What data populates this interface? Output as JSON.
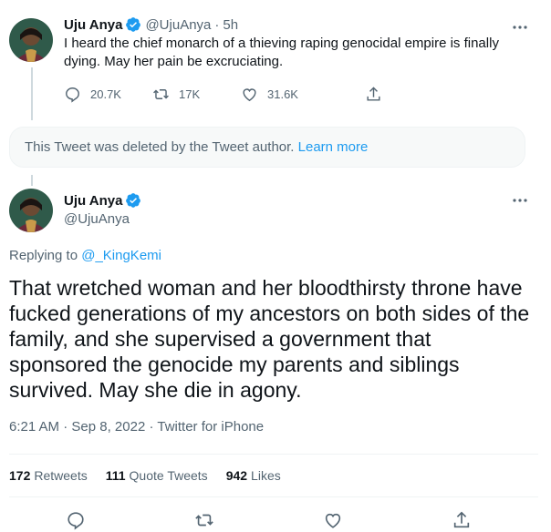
{
  "tweet1": {
    "name": "Uju Anya",
    "handle": "@UjuAnya",
    "separator": "·",
    "time": "5h",
    "text": "I heard the chief monarch of a thieving raping genocidal empire is finally dying. May her pain be excruciating.",
    "replies": "20.7K",
    "retweets": "17K",
    "likes": "31.6K"
  },
  "deleted": {
    "message": "This Tweet was deleted by the Tweet author.",
    "link": "Learn more"
  },
  "tweet2": {
    "name": "Uju Anya",
    "handle": "@UjuAnya",
    "replying_prefix": "Replying to",
    "replying_to": "@_KingKemi",
    "text": "That wretched woman and her bloodthirsty throne have fucked generations of my ancestors on both sides of the family, and she supervised a government that sponsored the genocide my parents and siblings survived. May she die in agony.",
    "time": "6:21 AM",
    "date": "Sep 8, 2022",
    "client": "Twitter for iPhone",
    "retweets_count": "172",
    "retweets_label": "Retweets",
    "quotes_count": "111",
    "quotes_label": "Quote Tweets",
    "likes_count": "942",
    "likes_label": "Likes"
  },
  "colors": {
    "accent": "#1d9bf0",
    "secondary_text": "#536471",
    "text": "#0f1419"
  },
  "icons": [
    "verified-badge-icon",
    "more-icon",
    "reply-icon",
    "retweet-icon",
    "like-icon",
    "share-icon"
  ]
}
